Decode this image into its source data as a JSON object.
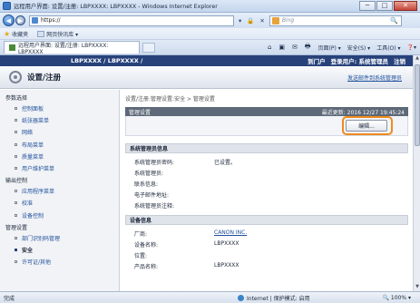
{
  "window": {
    "title": "远程用户界面: 设置/注册: LBPXXXX: LBPXXXX - Windows Internet Explorer",
    "minimize": "─",
    "maximize": "□",
    "close": "✕"
  },
  "address": {
    "back": "◀",
    "forward": "▶",
    "url": "https://",
    "tools": [
      "▾",
      "🔒",
      "✕"
    ],
    "search_placeholder": "Bing",
    "search_icon": "🔍"
  },
  "favorites": {
    "label": "收藏夹",
    "item": "网页快讯库 ▾"
  },
  "tab": {
    "title": "远程用户界面: 设置/注册: LBPXXXX: LBPXXXX"
  },
  "commands": {
    "home": "⌂",
    "feeds": "▣",
    "mail": "✉",
    "print": "🖶",
    "page": "页面(P) ▾",
    "safety": "安全(S) ▾",
    "tools": "工具(O) ▾",
    "help": "❓▾"
  },
  "device": {
    "model": "LBPXXXX / LBPXXXX /",
    "portal": "到门户",
    "login_user": "登录用户: 系统管理员",
    "logout": "注销"
  },
  "header": {
    "title": "设置/注册",
    "admin_link": "发送邮件到系统管理员"
  },
  "sidebar": {
    "groups": [
      {
        "label": "参数选择",
        "items": [
          {
            "label": "控制面板",
            "active": false
          },
          {
            "label": "纸张器菜单",
            "active": false
          },
          {
            "label": "网络",
            "active": false
          },
          {
            "label": "布局菜单",
            "active": false
          },
          {
            "label": "质量菜单",
            "active": false
          },
          {
            "label": "用户维护菜单",
            "active": false
          }
        ]
      },
      {
        "label": "输出控制",
        "items": [
          {
            "label": "应用程序菜单",
            "active": false
          },
          {
            "label": "校准",
            "active": false
          },
          {
            "label": "设备控制",
            "active": false
          }
        ]
      },
      {
        "label": "管理设置",
        "items": [
          {
            "label": "部门识别码管理",
            "active": false
          },
          {
            "label": "安全",
            "active": true
          },
          {
            "label": "许可证/其他",
            "active": false
          }
        ]
      }
    ]
  },
  "content": {
    "breadcrumb": "设置/注册:管理设置:安全 > 管理设置",
    "panel_title": "管理设置",
    "last_updated": "最近更新: 2016 12/27 19:45:24",
    "edit_button": "编辑...",
    "admin_section": {
      "title": "系统管理员信息",
      "rows": [
        {
          "k": "系统管理员密码:",
          "v": "已设置。"
        },
        {
          "k": "系统管理员:",
          "v": ""
        },
        {
          "k": "联系信息:",
          "v": ""
        },
        {
          "k": "电子邮件地址:",
          "v": ""
        },
        {
          "k": "系统管理员注释:",
          "v": ""
        }
      ]
    },
    "device_section": {
      "title": "设备信息",
      "rows": [
        {
          "k": "厂商:",
          "v": "CANON INC."
        },
        {
          "k": "设备名称:",
          "v": "LBPXXXX"
        },
        {
          "k": "位置:",
          "v": ""
        },
        {
          "k": "产品名称:",
          "v": "LBPXXXX"
        }
      ]
    }
  },
  "status": {
    "done": "完成",
    "zone": "Internet | 保护模式: 启用",
    "zoom": "🔍 100% ▾"
  }
}
